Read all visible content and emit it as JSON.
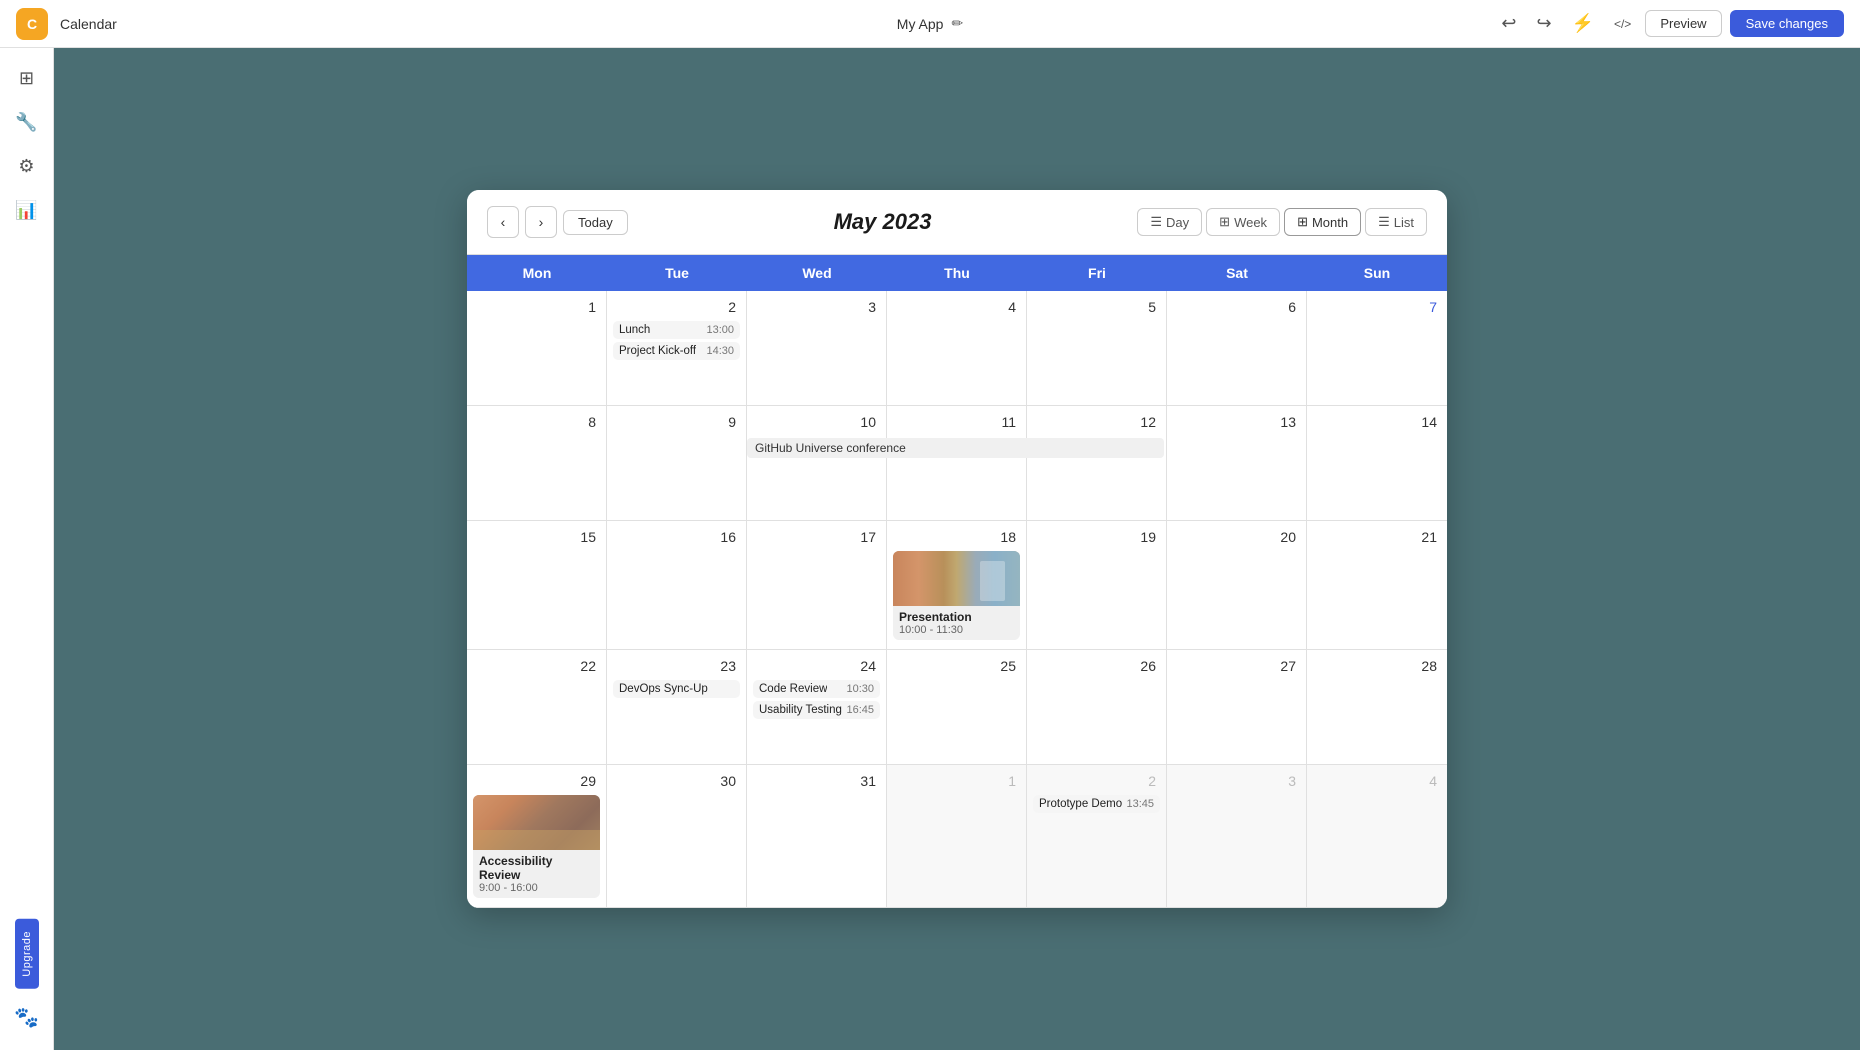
{
  "topbar": {
    "logo_text": "C",
    "app_label": "Calendar",
    "app_title": "My App",
    "edit_icon": "✏",
    "undo_icon": "↩",
    "redo_icon": "↪",
    "lock_icon": "⚡",
    "code_icon": "</>",
    "preview_label": "Preview",
    "save_label": "Save changes"
  },
  "sidebar": {
    "items": [
      {
        "name": "dashboard",
        "icon": "⊞"
      },
      {
        "name": "tools",
        "icon": "🔧"
      },
      {
        "name": "settings",
        "icon": "⚙"
      },
      {
        "name": "analytics",
        "icon": "📊"
      }
    ],
    "upgrade_label": "Upgrade"
  },
  "calendar": {
    "title": "May 2023",
    "prev_icon": "‹",
    "next_icon": "›",
    "today_label": "Today",
    "views": [
      {
        "id": "day",
        "label": "Day",
        "icon": "☰"
      },
      {
        "id": "week",
        "label": "Week",
        "icon": "⊞"
      },
      {
        "id": "month",
        "label": "Month",
        "icon": "⊞",
        "active": true
      },
      {
        "id": "list",
        "label": "List",
        "icon": "☰"
      }
    ],
    "day_headers": [
      "Mon",
      "Tue",
      "Wed",
      "Thu",
      "Fri",
      "Sat",
      "Sun"
    ],
    "weeks": [
      {
        "days": [
          {
            "date": "1",
            "month": "current",
            "events": []
          },
          {
            "date": "2",
            "month": "current",
            "events": [
              {
                "name": "Lunch",
                "time": "13:00",
                "type": "simple"
              },
              {
                "name": "Project Kick-off",
                "time": "14:30",
                "type": "simple"
              }
            ]
          },
          {
            "date": "3",
            "month": "current",
            "events": []
          },
          {
            "date": "4",
            "month": "current",
            "events": []
          },
          {
            "date": "5",
            "month": "current",
            "events": []
          },
          {
            "date": "6",
            "month": "current",
            "events": []
          },
          {
            "date": "7",
            "month": "current",
            "sunday": true,
            "events": []
          }
        ]
      },
      {
        "days": [
          {
            "date": "8",
            "month": "current",
            "events": []
          },
          {
            "date": "9",
            "month": "current",
            "events": []
          },
          {
            "date": "10",
            "month": "current",
            "events": [
              {
                "name": "GitHub Universe conference",
                "type": "multiday",
                "span": true
              }
            ]
          },
          {
            "date": "11",
            "month": "current",
            "events": [
              {
                "name": "GitHub Universe conference",
                "type": "multiday-cont"
              }
            ]
          },
          {
            "date": "12",
            "month": "current",
            "events": [
              {
                "name": "GitHub Universe conference",
                "type": "multiday-cont"
              }
            ]
          },
          {
            "date": "13",
            "month": "current",
            "events": []
          },
          {
            "date": "14",
            "month": "current",
            "events": []
          }
        ]
      },
      {
        "days": [
          {
            "date": "15",
            "month": "current",
            "events": []
          },
          {
            "date": "16",
            "month": "current",
            "events": []
          },
          {
            "date": "17",
            "month": "current",
            "events": []
          },
          {
            "date": "18",
            "month": "current",
            "events": [
              {
                "name": "Presentation",
                "time": "10:00 - 11:30",
                "type": "with-image"
              }
            ]
          },
          {
            "date": "19",
            "month": "current",
            "events": []
          },
          {
            "date": "20",
            "month": "current",
            "events": []
          },
          {
            "date": "21",
            "month": "current",
            "events": []
          }
        ]
      },
      {
        "days": [
          {
            "date": "22",
            "month": "current",
            "events": []
          },
          {
            "date": "23",
            "month": "current",
            "events": [
              {
                "name": "DevOps Sync-Up",
                "type": "simple-no-time"
              }
            ]
          },
          {
            "date": "24",
            "month": "current",
            "events": [
              {
                "name": "Code Review",
                "time": "10:30",
                "type": "simple"
              },
              {
                "name": "Usability Testing",
                "time": "16:45",
                "type": "simple"
              }
            ]
          },
          {
            "date": "25",
            "month": "current",
            "events": []
          },
          {
            "date": "26",
            "month": "current",
            "events": []
          },
          {
            "date": "27",
            "month": "current",
            "events": []
          },
          {
            "date": "28",
            "month": "current",
            "events": []
          }
        ]
      },
      {
        "days": [
          {
            "date": "29",
            "month": "current",
            "events": [
              {
                "name": "Accessibility Review",
                "time": "9:00 - 16:00",
                "type": "with-image-acc"
              }
            ]
          },
          {
            "date": "30",
            "month": "current",
            "events": []
          },
          {
            "date": "31",
            "month": "current",
            "events": []
          },
          {
            "date": "1",
            "month": "other",
            "events": []
          },
          {
            "date": "2",
            "month": "other",
            "events": [
              {
                "name": "Prototype Demo",
                "time": "13:45",
                "type": "simple"
              }
            ]
          },
          {
            "date": "3",
            "month": "other",
            "events": []
          },
          {
            "date": "4",
            "month": "other",
            "events": []
          }
        ]
      }
    ]
  }
}
